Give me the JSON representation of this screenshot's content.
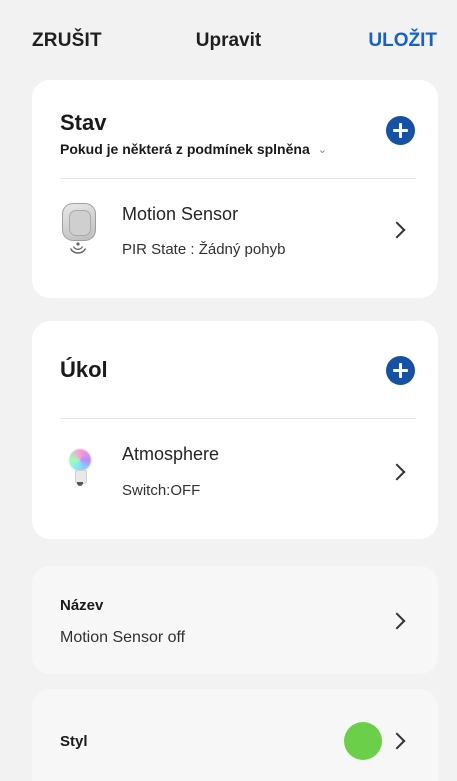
{
  "header": {
    "cancel_label": "ZRUŠIT",
    "title": "Upravit",
    "save_label": "ULOŽIT"
  },
  "condition": {
    "title": "Stav",
    "mode_label": "Pokud je některá z podmínek splněna",
    "mode_caret": "⌄",
    "items": [
      {
        "name": "Motion Sensor",
        "detail": "PIR State : Žádný pohyb",
        "icon": "motion-sensor-icon"
      }
    ]
  },
  "task": {
    "title": "Úkol",
    "items": [
      {
        "name": "Atmosphere",
        "detail": "Switch:OFF",
        "icon": "light-bulb-icon"
      }
    ]
  },
  "name_section": {
    "label": "Název",
    "value": "Motion Sensor off"
  },
  "style_section": {
    "label": "Styl",
    "color": "#6ccf4a"
  },
  "colors": {
    "accent": "#1461c8",
    "plus_button": "#1650a8",
    "background": "#f2f2f2"
  }
}
